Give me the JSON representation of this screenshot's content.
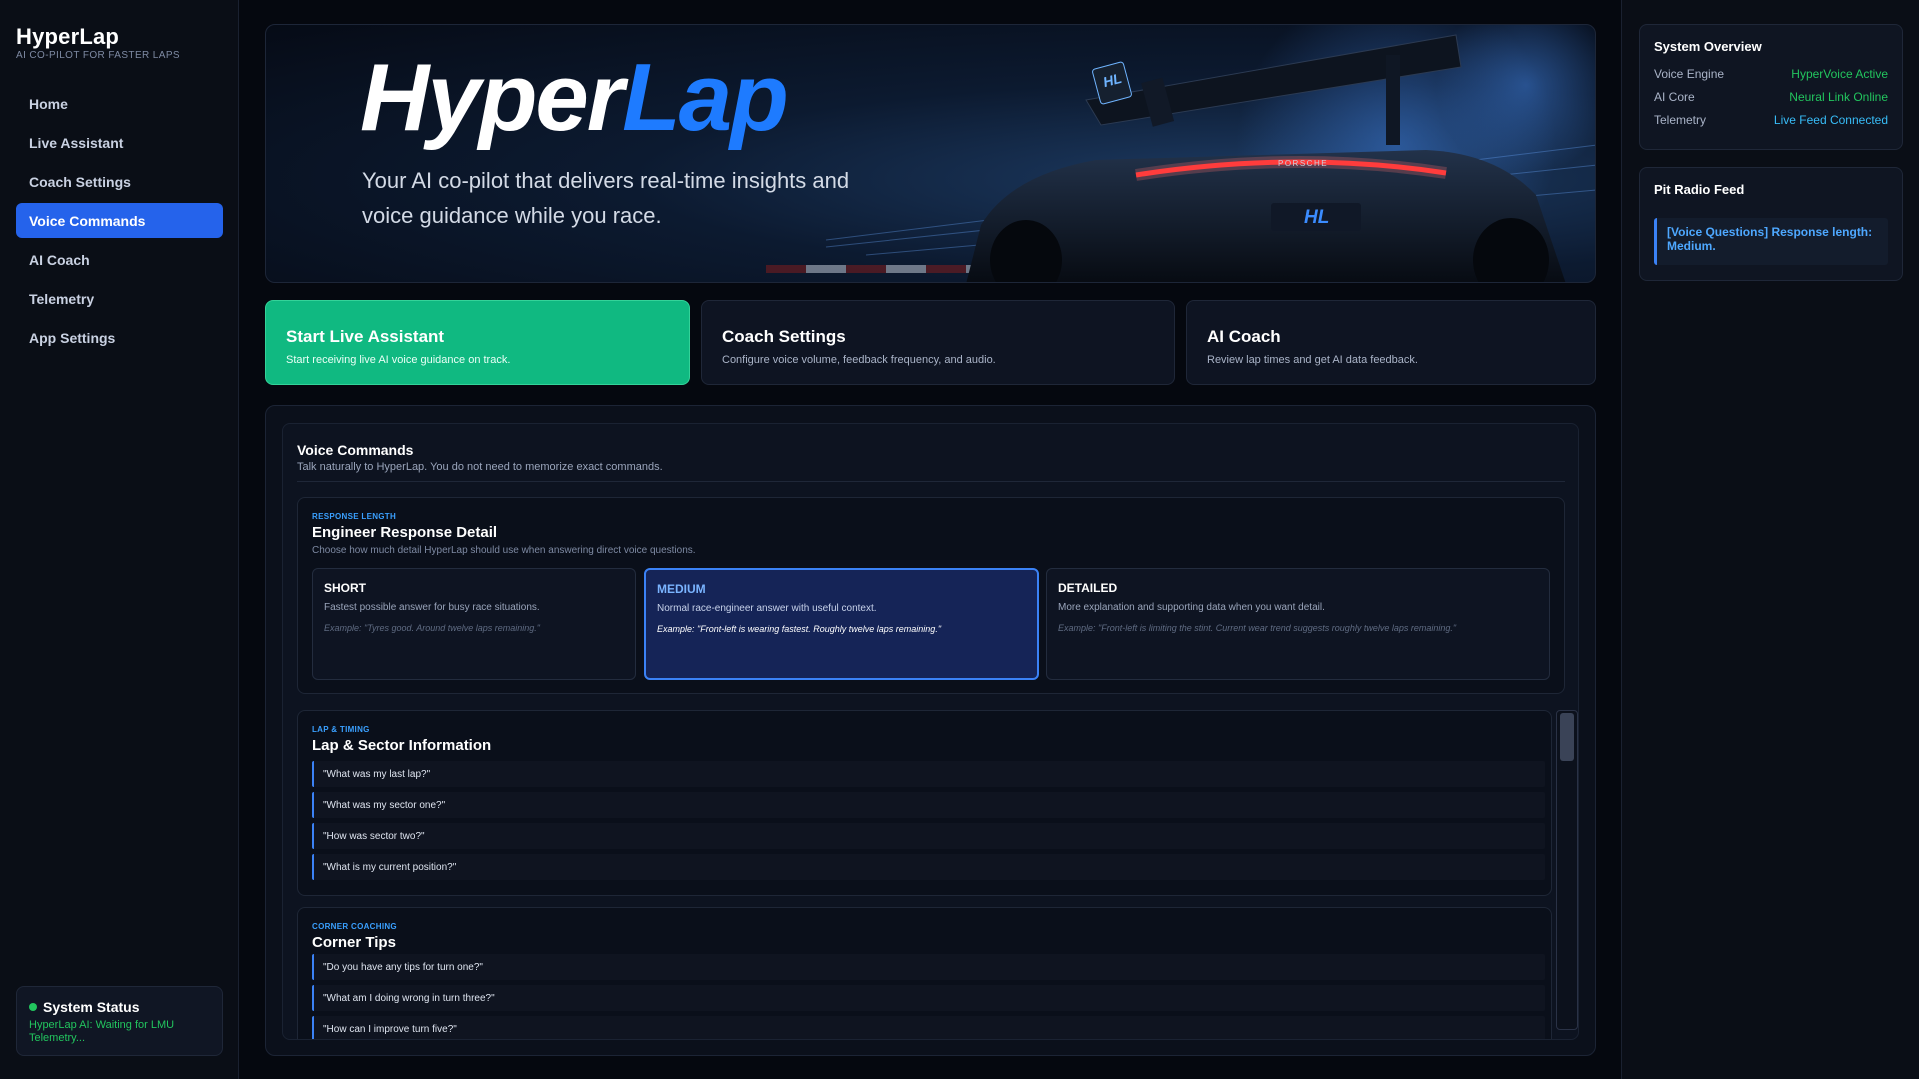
{
  "sidebar": {
    "brand_title": "HyperLap",
    "brand_sub": "AI CO-PILOT FOR FASTER LAPS",
    "items": [
      {
        "label": "Home"
      },
      {
        "label": "Live Assistant"
      },
      {
        "label": "Coach Settings"
      },
      {
        "label": "Voice Commands",
        "active": true
      },
      {
        "label": "AI Coach"
      },
      {
        "label": "Telemetry"
      },
      {
        "label": "App Settings"
      }
    ],
    "status": {
      "title": "System Status",
      "text": "HyperLap AI: Waiting for LMU Telemetry..."
    }
  },
  "hero": {
    "title_white": "Hyper",
    "title_blue": "Lap",
    "tagline": "Your AI co-pilot that delivers real-time insights and voice guidance while you race.",
    "car_badge": "HL",
    "car_brand": "PORSCHE"
  },
  "quick_actions": [
    {
      "title": "Start Live Assistant",
      "desc": "Start receiving live AI voice guidance on track."
    },
    {
      "title": "Coach Settings",
      "desc": "Configure voice volume, feedback frequency, and audio."
    },
    {
      "title": "AI Coach",
      "desc": "Review lap times and get AI data feedback."
    }
  ],
  "voice_commands": {
    "title": "Voice Commands",
    "subtitle": "Talk naturally to HyperLap. You do not need to memorize exact commands.",
    "response": {
      "eyebrow": "RESPONSE LENGTH",
      "title": "Engineer Response Detail",
      "desc": "Choose how much detail HyperLap should use when answering direct voice questions.",
      "options": [
        {
          "title": "SHORT",
          "desc": "Fastest possible answer for busy race situations.",
          "example": "Example: \"Tyres good. Around twelve laps remaining.\""
        },
        {
          "title": "MEDIUM",
          "desc": "Normal race-engineer answer with useful context.",
          "example": "Example: \"Front-left is wearing fastest. Roughly twelve laps remaining.\"",
          "selected": true
        },
        {
          "title": "DETAILED",
          "desc": "More explanation and supporting data when you want detail.",
          "example": "Example: \"Front-left is limiting the stint. Current wear trend suggests roughly twelve laps remaining.\""
        }
      ]
    },
    "lap": {
      "eyebrow": "LAP & TIMING",
      "title": "Lap & Sector Information",
      "commands": [
        "\"What was my last lap?\"",
        "\"What was my sector one?\"",
        "\"How was sector two?\"",
        "\"What is my current position?\""
      ]
    },
    "corner": {
      "eyebrow": "CORNER COACHING",
      "title": "Corner Tips",
      "commands": [
        "\"Do you have any tips for turn one?\"",
        "\"What am I doing wrong in turn three?\"",
        "\"How can I improve turn five?\""
      ]
    }
  },
  "system_overview": {
    "title": "System Overview",
    "rows": [
      {
        "label": "Voice Engine",
        "value": "HyperVoice Active",
        "color": "#22c55e"
      },
      {
        "label": "AI Core",
        "value": "Neural Link Online",
        "color": "#22c55e"
      },
      {
        "label": "Telemetry",
        "value": "Live Feed Connected",
        "color": "#38bdf8"
      }
    ]
  },
  "pit_radio": {
    "title": "Pit Radio Feed",
    "message": "[Voice Questions] Response length: Medium."
  },
  "colors": {
    "accent": "#2563eb",
    "success": "#10b981",
    "brand_blue": "#1e7bff"
  },
  "icons": {
    "status": "status-dot-icon"
  }
}
